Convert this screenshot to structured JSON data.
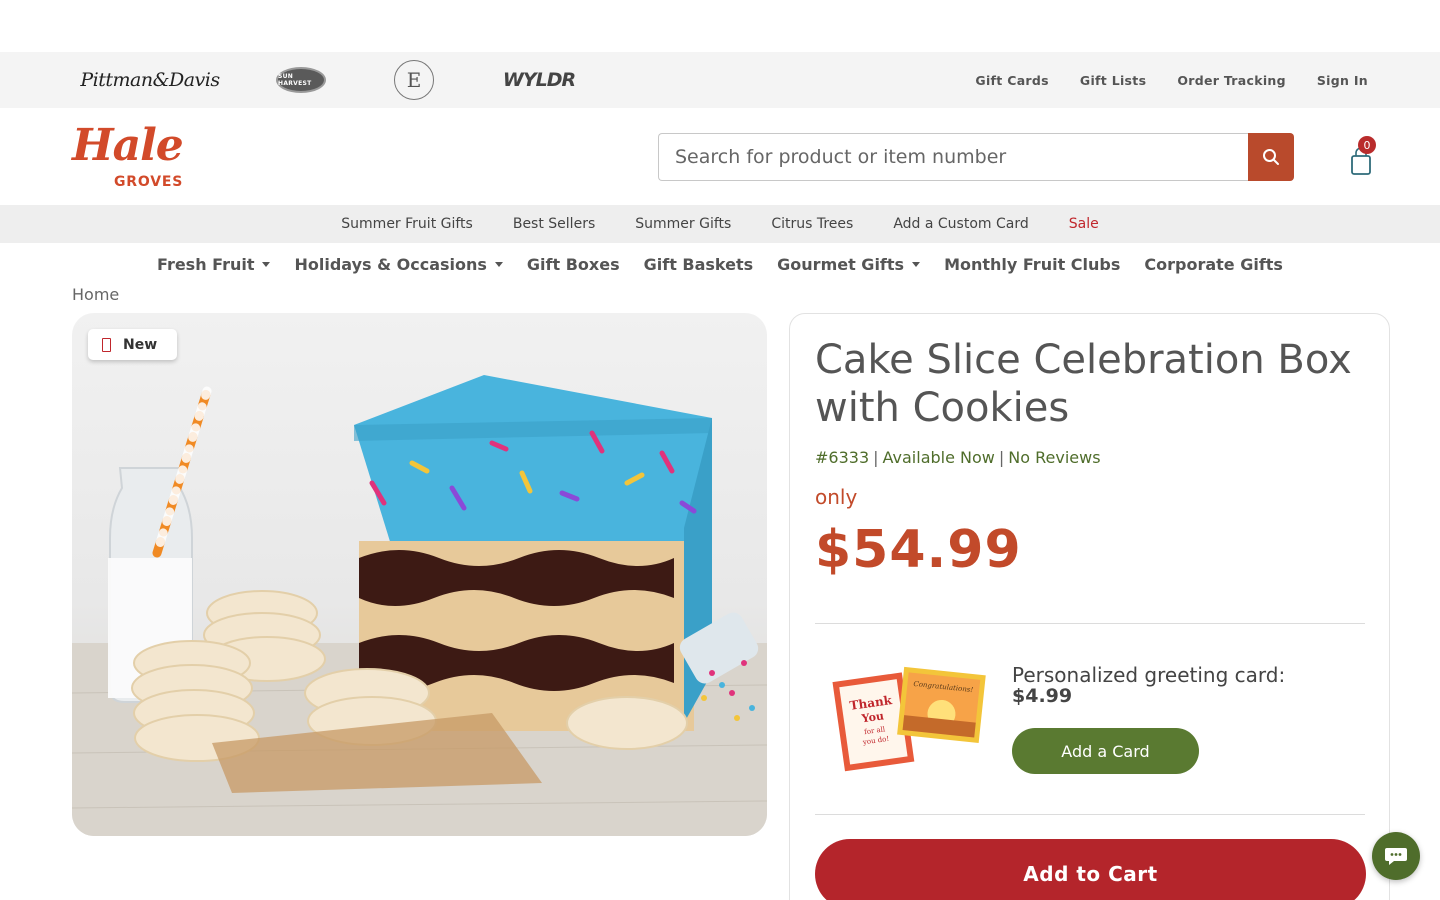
{
  "brand_bar": {
    "brands": [
      "Pittman&Davis",
      "SUN HARVEST",
      "E",
      "WYLDR"
    ],
    "links": [
      "Gift Cards",
      "Gift Lists",
      "Order Tracking",
      "Sign In"
    ]
  },
  "header": {
    "logo_word": "Hale",
    "logo_sub": "GROVES",
    "search_placeholder": "Search for product or item number",
    "cart_count": "0"
  },
  "promo_nav": [
    "Summer Fruit Gifts",
    "Best Sellers",
    "Summer Gifts",
    "Citrus Trees",
    "Add a Custom Card",
    "Sale"
  ],
  "main_nav": [
    "Fresh Fruit",
    "Holidays & Occasions",
    "Gift Boxes",
    "Gift Baskets",
    "Gourmet Gifts",
    "Monthly Fruit Clubs",
    "Corporate Gifts"
  ],
  "breadcrumb": "Home",
  "product": {
    "badge": "New",
    "title": "Cake Slice Celebration Box with Cookies",
    "item_number": "#6333",
    "availability": "Available Now",
    "reviews": "No Reviews",
    "price_prefix": "only",
    "price": "$54.99",
    "greeting_label": "Personalized greeting card:",
    "greeting_price": "$4.99",
    "add_card_label": "Add a Card",
    "add_to_cart_label": "Add to Cart",
    "card_art_text": [
      "Thank",
      "You",
      "for all",
      "you do!",
      "Congratulations!"
    ]
  },
  "colors": {
    "brand_orange": "#d24a2a",
    "price_red": "#c24a2a",
    "cart_red": "#b4252b",
    "green": "#5a7a31",
    "meta_green": "#4f6d2b",
    "sale_red": "#c0262c"
  }
}
